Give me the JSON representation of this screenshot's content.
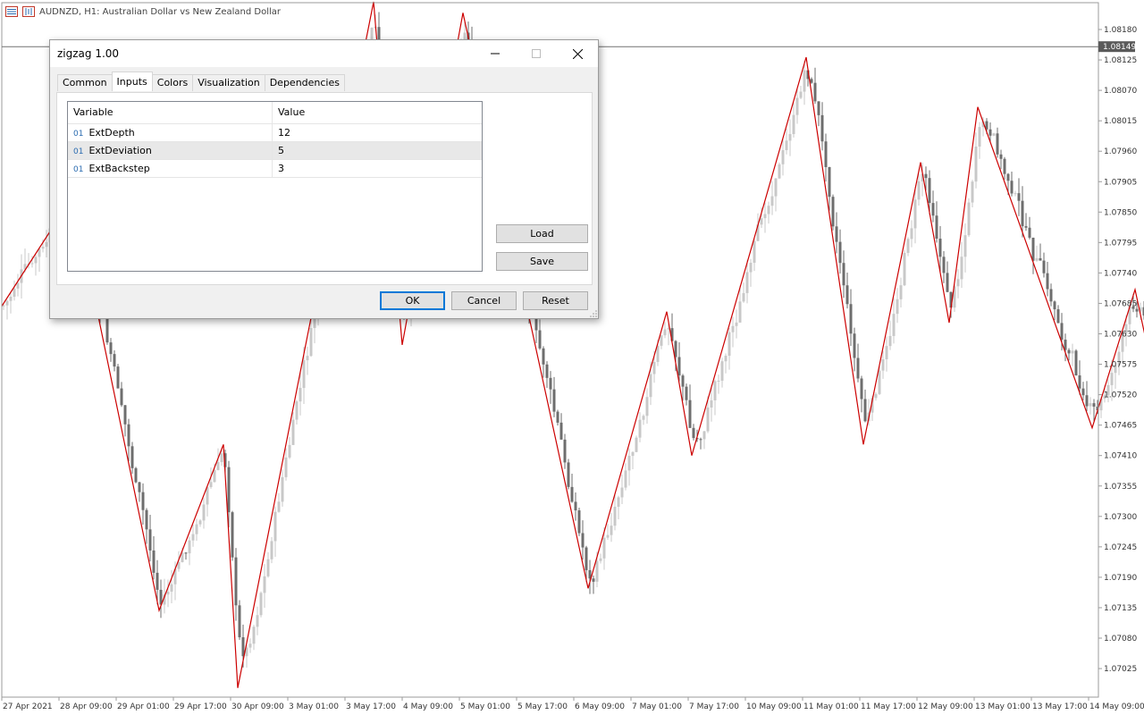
{
  "chart": {
    "symbol_line": "AUDNZD, H1:  Australian Dollar vs New Zealand Dollar",
    "price_labels": [
      "1.08180",
      "1.08125",
      "1.08070",
      "1.08015",
      "1.07960",
      "1.07905",
      "1.07850",
      "1.07795",
      "1.07740",
      "1.07685",
      "1.07630",
      "1.07575",
      "1.07520",
      "1.07465",
      "1.07410",
      "1.07355",
      "1.07300",
      "1.07245",
      "1.07190",
      "1.07135",
      "1.07080",
      "1.07025"
    ],
    "current_price": "1.08149",
    "time_labels": [
      "27 Apr 2021",
      "28 Apr 09:00",
      "29 Apr 01:00",
      "29 Apr 17:00",
      "30 Apr 09:00",
      "3 May 01:00",
      "3 May 17:00",
      "4 May 09:00",
      "5 May 01:00",
      "5 May 17:00",
      "6 May 09:00",
      "7 May 01:00",
      "7 May 17:00",
      "10 May 09:00",
      "11 May 01:00",
      "11 May 17:00",
      "12 May 09:00",
      "13 May 01:00",
      "13 May 17:00",
      "14 May 09:00"
    ],
    "colors": {
      "zigzag": "#cc0000",
      "candle_bull": "#c8c8c8",
      "candle_bear": "#6e6e6e",
      "price_tag_bg": "#5a5a5a",
      "axis": "#9b9b9b"
    }
  },
  "chart_data": {
    "type": "line",
    "title": "AUDNZD, H1:  Australian Dollar vs New Zealand Dollar",
    "xlabel": "",
    "ylabel": "",
    "ylim": [
      1.0699,
      1.0822
    ],
    "series": [
      {
        "points": [
          {
            "x": "27 Apr 2021 00:00",
            "y": 1.0768
          },
          {
            "x": "27 Apr 2021 20:00",
            "y": 1.0788
          },
          {
            "x": "28 Apr 20:00",
            "y": 1.0713
          },
          {
            "x": "29 Apr 14:00",
            "y": 1.0743
          },
          {
            "x": "29 Apr 18:00",
            "y": 1.0699
          },
          {
            "x": "3 May 08:00",
            "y": 1.0823
          },
          {
            "x": "3 May 16:00",
            "y": 1.0761
          },
          {
            "x": "4 May 09:00",
            "y": 1.0821
          },
          {
            "x": "5 May 20:00",
            "y": 1.0717
          },
          {
            "x": "6 May 18:00",
            "y": 1.0767
          },
          {
            "x": "7 May 01:00",
            "y": 1.0741
          },
          {
            "x": "10 May 09:00",
            "y": 1.0813
          },
          {
            "x": "11 May 01:00",
            "y": 1.0743
          },
          {
            "x": "11 May 17:00",
            "y": 1.0794
          },
          {
            "x": "12 May 01:00",
            "y": 1.0765
          },
          {
            "x": "12 May 09:00",
            "y": 1.0804
          },
          {
            "x": "13 May 17:00",
            "y": 1.0746
          },
          {
            "x": "14 May 05:00",
            "y": 1.0771
          },
          {
            "x": "14 May 09:00",
            "y": 1.0759
          }
        ]
      }
    ]
  },
  "dialog": {
    "title": "zigzag 1.00",
    "tabs": [
      "Common",
      "Inputs",
      "Colors",
      "Visualization",
      "Dependencies"
    ],
    "active_tab": "Inputs",
    "grid": {
      "headers": [
        "Variable",
        "Value"
      ],
      "type_badge": "01",
      "rows": [
        {
          "variable": "ExtDepth",
          "value": "12"
        },
        {
          "variable": "ExtDeviation",
          "value": "5"
        },
        {
          "variable": "ExtBackstep",
          "value": "3"
        }
      ]
    },
    "load_label": "Load",
    "save_label": "Save",
    "ok_label": "OK",
    "cancel_label": "Cancel",
    "reset_label": "Reset"
  }
}
